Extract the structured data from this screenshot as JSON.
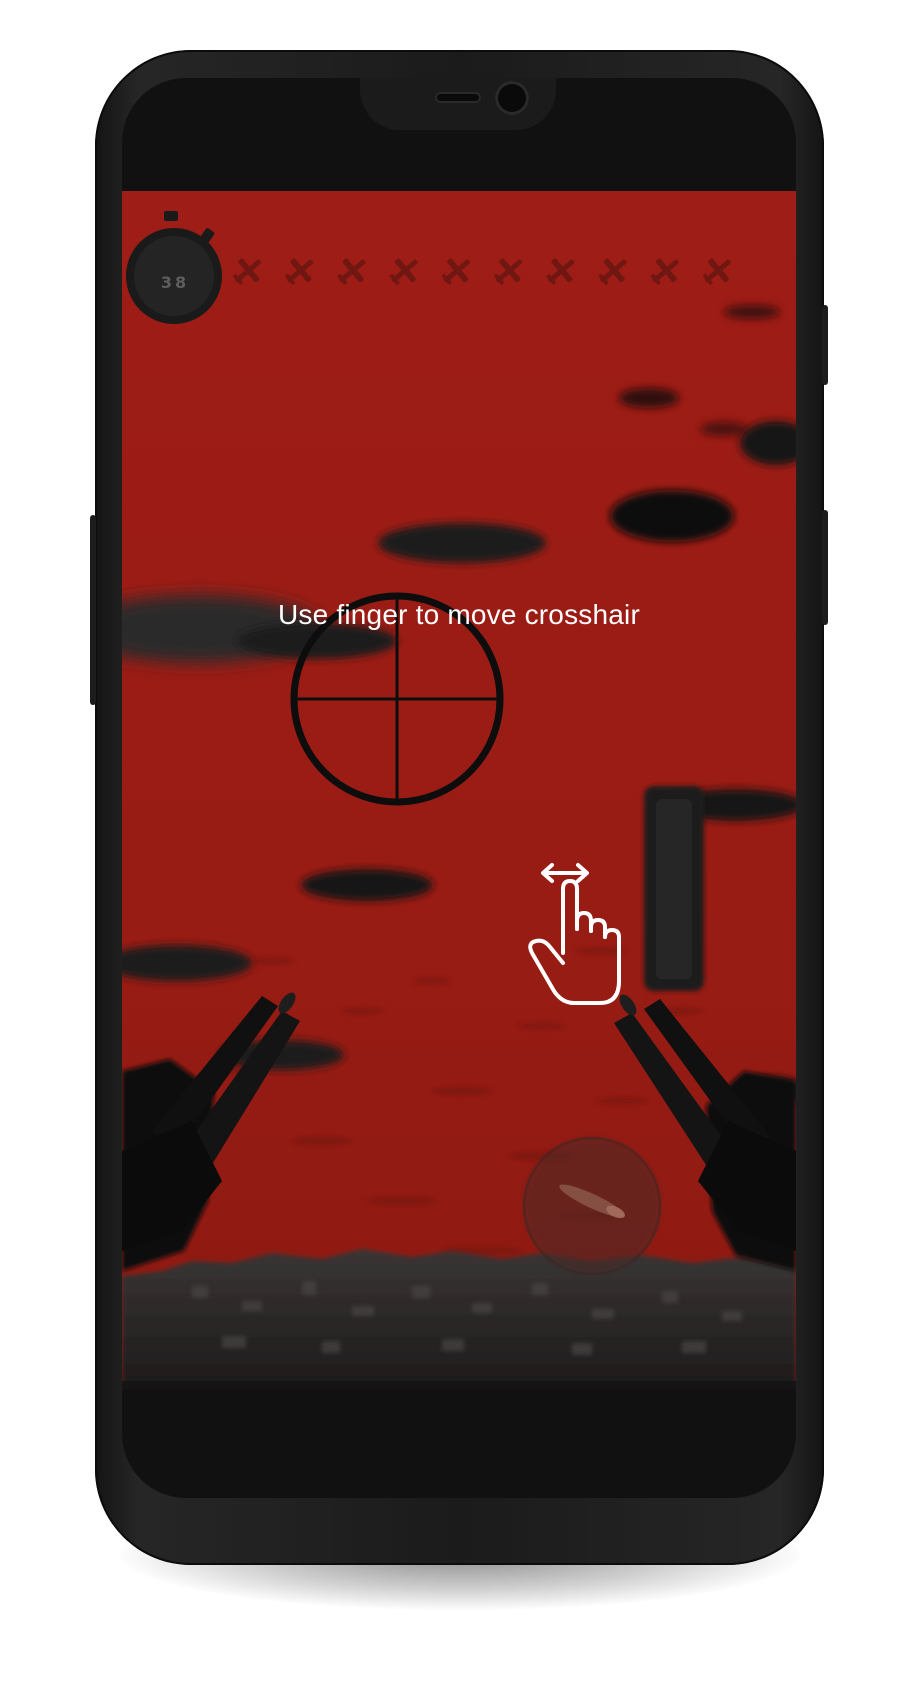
{
  "tutorial": {
    "hint_text": "Use finger to move crosshair"
  },
  "hud": {
    "timer_value": "38",
    "remaining_planes": 10,
    "plane_icon": "plane-silhouette-icon",
    "timer_icon": "stopwatch-icon"
  },
  "controls": {
    "fire_button_icon": "bullet-icon",
    "power_gauge": "vertical-gauge",
    "swipe_hint_icon": "swipe-horizontal-hand-icon"
  },
  "colors": {
    "sky": "#9a1d15",
    "hud_dark": "#1a1a1a",
    "crosshair": "#0d0d0d",
    "text": "#ffffff"
  }
}
